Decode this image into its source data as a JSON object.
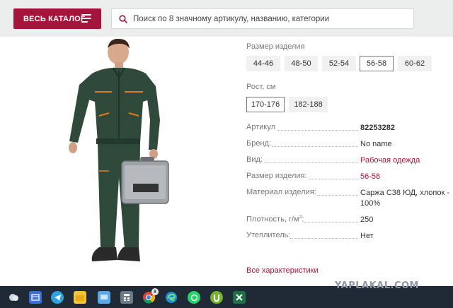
{
  "header": {
    "catalog_label": "ВЕСЬ КАТАЛОГ",
    "search_placeholder": "Поиск по 8 значному артикулу, названию, категории"
  },
  "size_section": {
    "label": "Размер изделия",
    "options": [
      "44-46",
      "48-50",
      "52-54",
      "56-58",
      "60-62"
    ],
    "selected": "56-58"
  },
  "height_section": {
    "label": "Рост, см",
    "options": [
      "170-176",
      "182-188"
    ],
    "selected": "170-176"
  },
  "specs": [
    {
      "label": "Артикул",
      "value": "82253282"
    },
    {
      "label": "Бренд:",
      "value": "No name"
    },
    {
      "label": "Вид:",
      "value": "Рабочая одежда"
    },
    {
      "label": "Размер изделия:",
      "value": "56-58"
    },
    {
      "label": "Материал изделия:",
      "value": "Саржа С38 ЮД, хлопок - 100%"
    },
    {
      "label": "Плотность, г/м",
      "label_sup": "2",
      "label_suffix": ":",
      "value": "250"
    },
    {
      "label": "Утеплитель:",
      "value": "Нет"
    }
  ],
  "all_characteristics_label": "Все характеристики",
  "watermark": "YAPLAKAL.COM",
  "taskbar": {
    "icons": [
      "weather-icon",
      "file-explorer-icon",
      "telegram-icon",
      "folder-icon",
      "control-panel-icon",
      "calculator-icon",
      "chrome-icon",
      "edge-icon",
      "whatsapp-icon",
      "utorrent-icon",
      "excel-icon"
    ],
    "chrome_badge": "8"
  },
  "colors": {
    "accent": "#a3153b",
    "header_bg": "#eceded",
    "taskbar_bg": "#1f2a36"
  }
}
